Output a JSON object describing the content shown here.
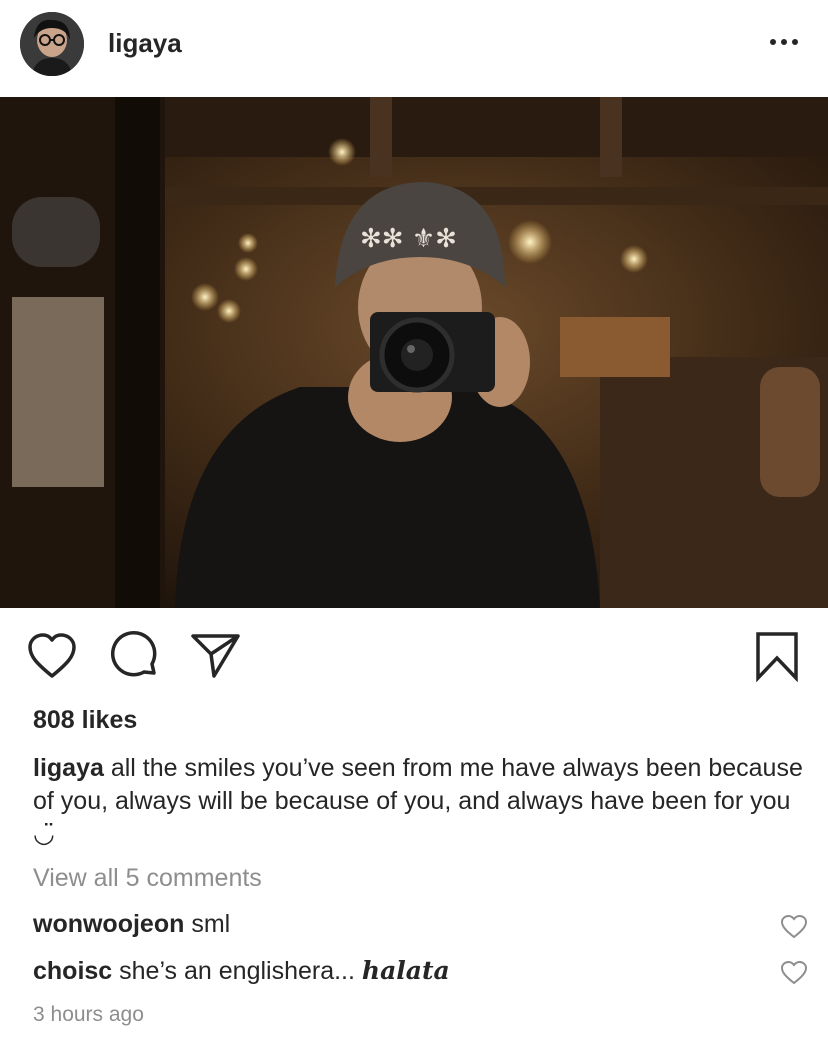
{
  "header": {
    "username": "ligaya",
    "more_icon": "more-horizontal-icon"
  },
  "photo": {
    "description_icon": "post-photo"
  },
  "actions": {
    "like_icon": "heart-icon",
    "comment_icon": "comment-icon",
    "share_icon": "share-icon",
    "save_icon": "bookmark-icon"
  },
  "post": {
    "likes": "808 likes",
    "caption_username": "ligaya",
    "caption_text": " all the smiles you’ve seen from me have always been because of you, always will be because of you, and always have been for you ◡̈",
    "view_all_comments": "View all 5 comments",
    "comments": [
      {
        "username": "wonwoojeon",
        "text": " sml"
      },
      {
        "username": "choisc",
        "text": " she’s an englishera... ",
        "styled_text": "halata"
      }
    ],
    "timestamp": "3 hours ago"
  },
  "colors": {
    "text": "#262626",
    "muted": "#8e8e8e",
    "background": "#ffffff"
  }
}
